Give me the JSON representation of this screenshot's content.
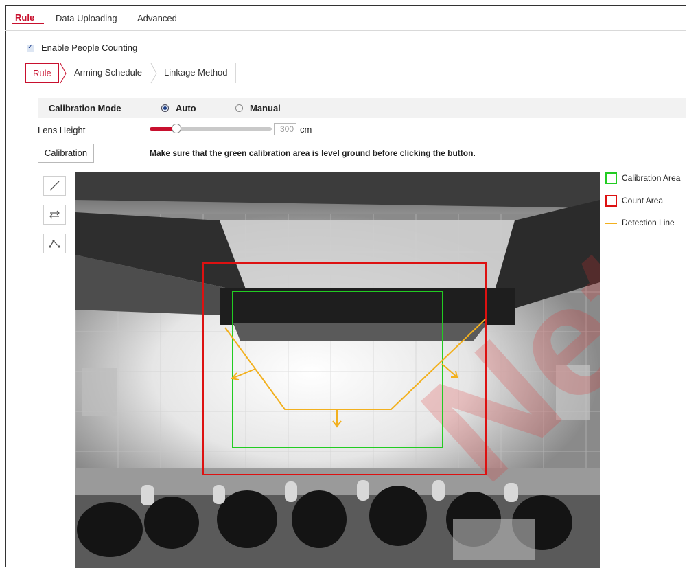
{
  "top_tabs": [
    "Rule",
    "Data Uploading",
    "Advanced"
  ],
  "enable_label": "Enable People Counting",
  "enable_checked": true,
  "sub_tabs": [
    "Rule",
    "Arming Schedule",
    "Linkage Method"
  ],
  "calibration": {
    "mode_label": "Calibration Mode",
    "auto_label": "Auto",
    "manual_label": "Manual",
    "selected": "Auto"
  },
  "lens": {
    "label": "Lens Height",
    "value": "300",
    "unit": "cm",
    "level": 0.22
  },
  "calibration_button": "Calibration",
  "hint": "Make sure that the green calibration area is level ground before clicking the button.",
  "tools": [
    "draw-line-icon",
    "swap-direction-icon",
    "polyline-icon"
  ],
  "legend": [
    {
      "label": "Calibration Area",
      "color": "#22cc22"
    },
    {
      "label": "Count Area",
      "color": "#dd1111"
    },
    {
      "label": "Detection Line",
      "color": "#f2b01e"
    }
  ],
  "colors": {
    "accent": "#c8102e"
  }
}
